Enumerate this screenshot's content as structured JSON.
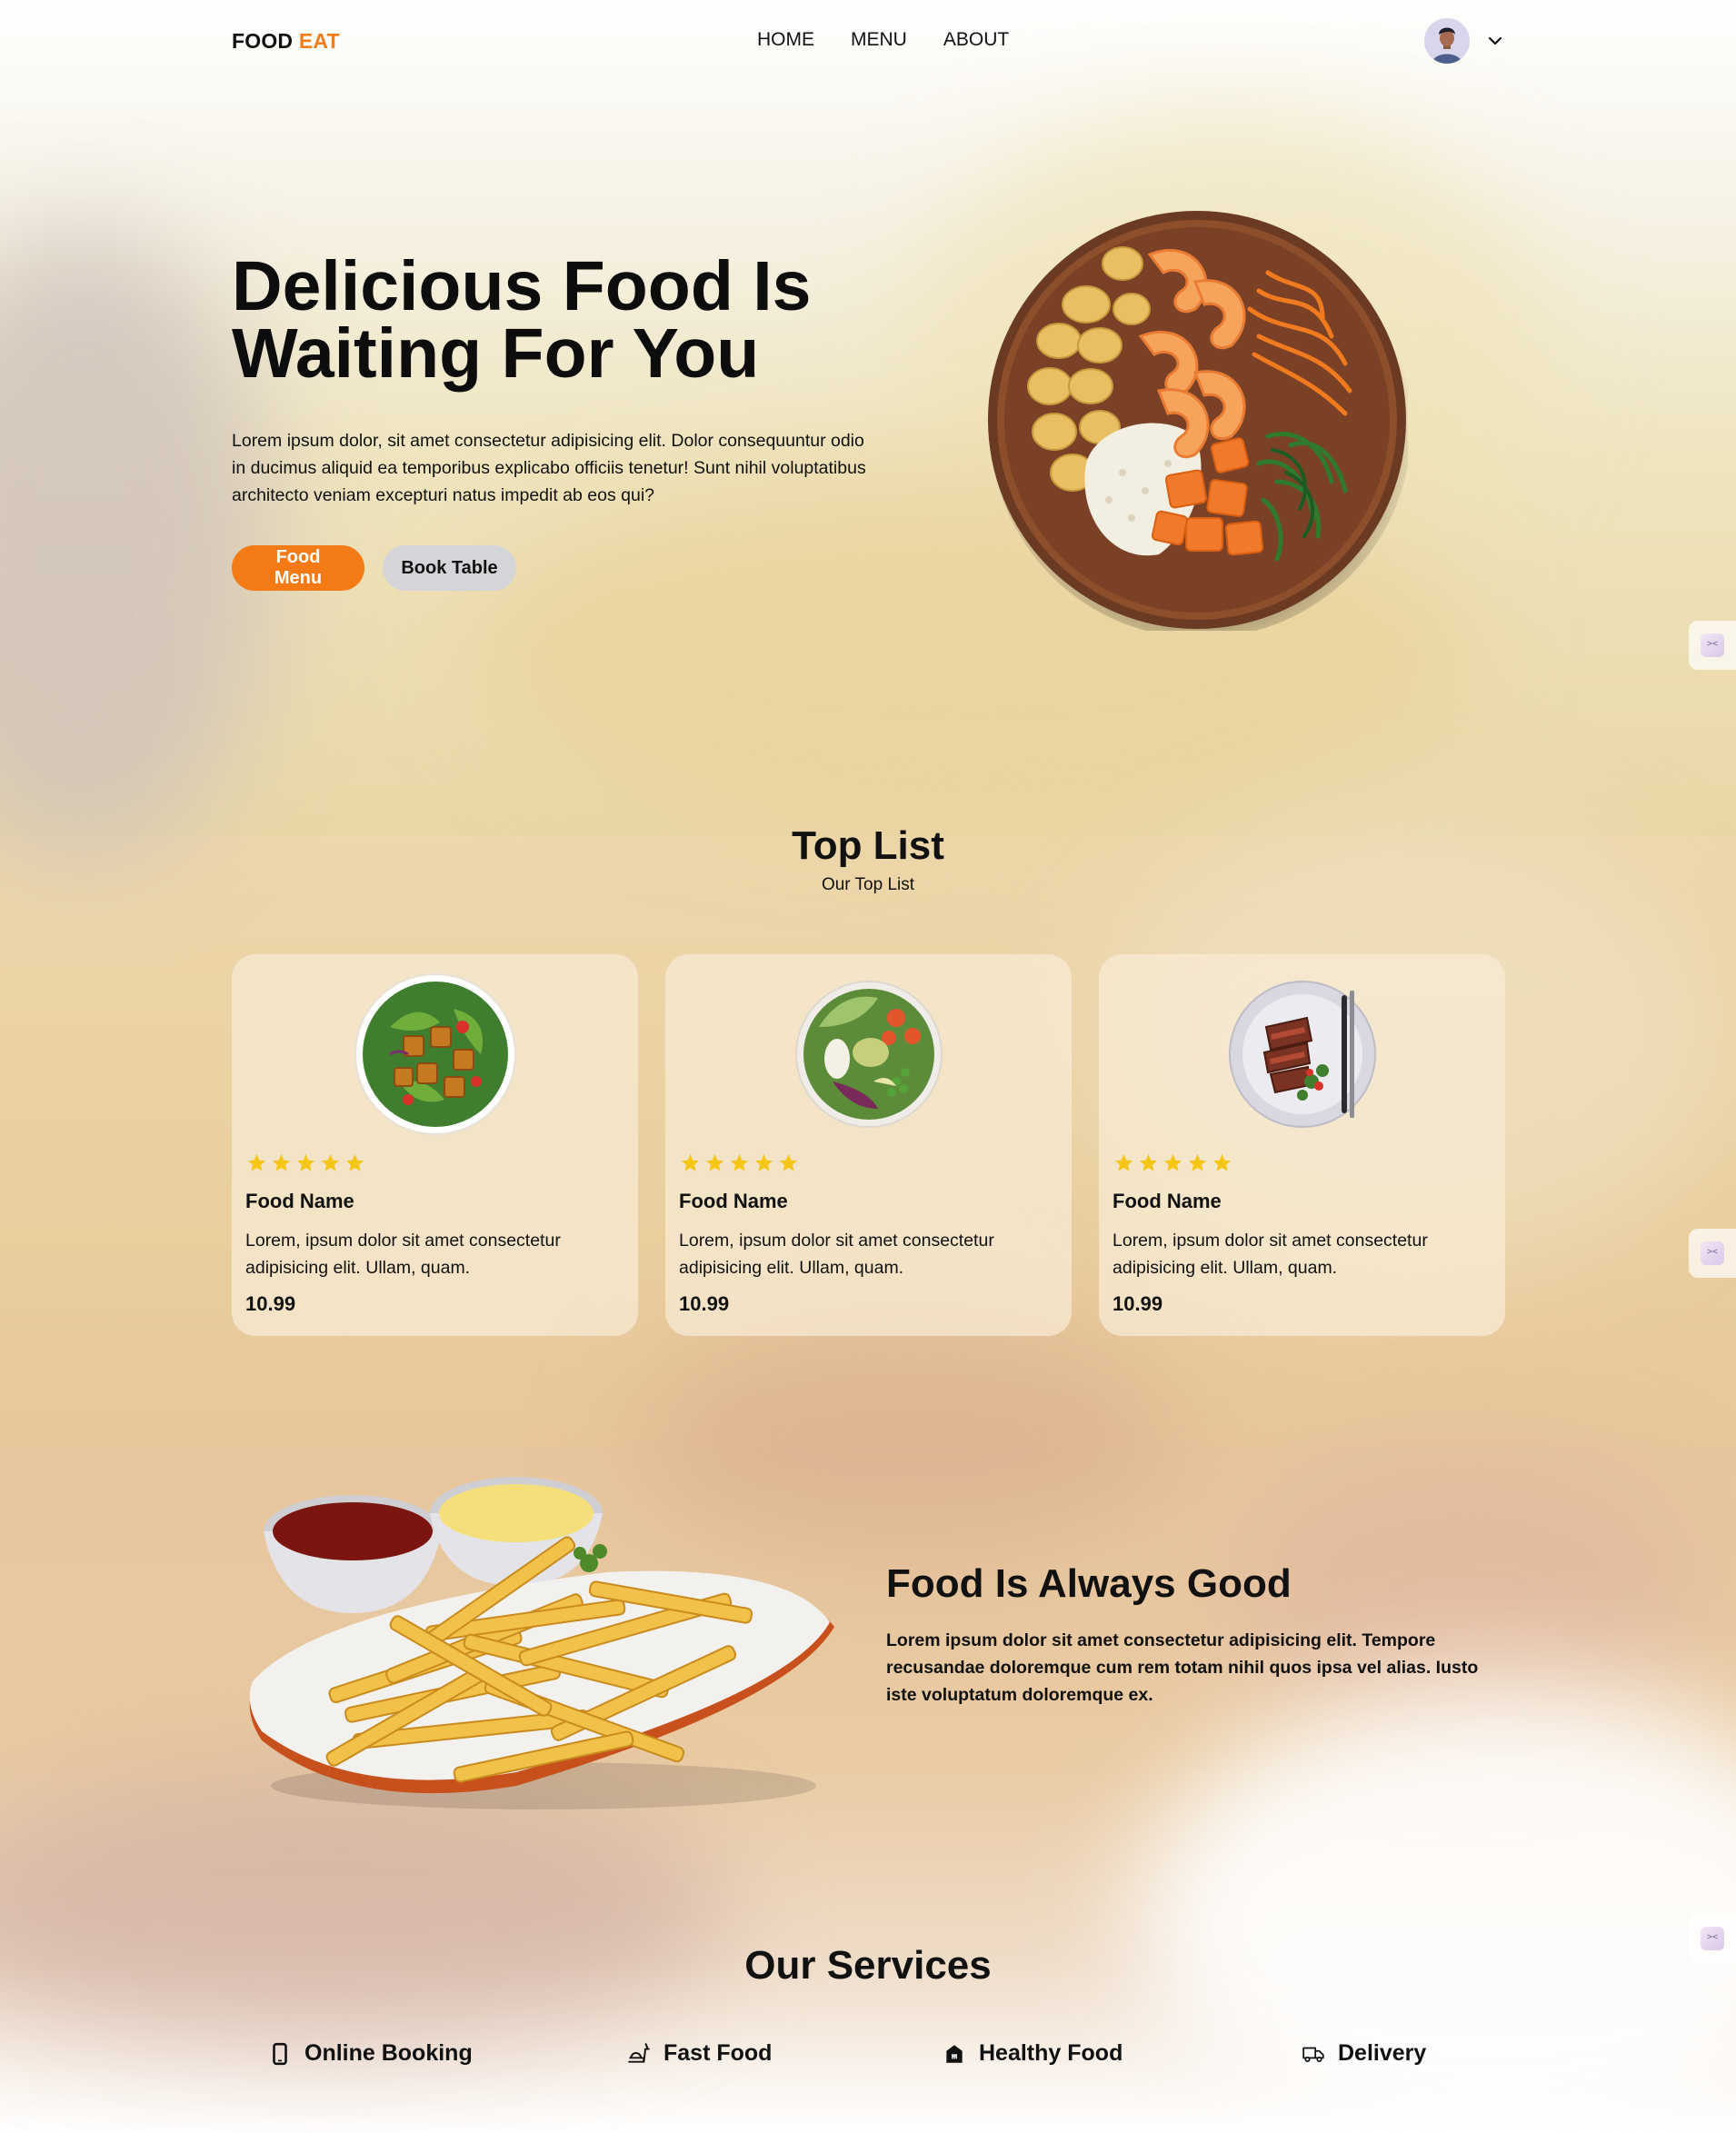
{
  "brand": {
    "part1": "FOOD",
    "part2": "EAT",
    "accent_color": "#f07c1a"
  },
  "nav": {
    "items": [
      "HOME",
      "MENU",
      "ABOUT"
    ]
  },
  "user": {
    "avatar_icon": "user-avatar-icon",
    "menu_icon": "chevron-down-icon"
  },
  "hero": {
    "title_line1": "Delicious Food Is",
    "title_line2": "Waiting For You",
    "text": "Lorem ipsum dolor, sit amet consectetur adipisicing elit. Dolor consequuntur odio in ducimus aliquid ea temporibus explicabo officiis tenetur! Sunt nihil voluptatibus architecto veniam excepturi natus impedit ab eos qui?",
    "primary_button": "Food Menu",
    "secondary_button": "Book Table",
    "primary_color": "#f47a15"
  },
  "top_list": {
    "title": "Top List",
    "subtitle": "Our Top List",
    "cards": [
      {
        "image": "salad-bowl",
        "rating": 5,
        "name": "Food Name",
        "description": "Lorem, ipsum dolor sit amet consectetur adipisicing elit. Ullam, quam.",
        "price": "10.99"
      },
      {
        "image": "veggie-bowl",
        "rating": 5,
        "name": "Food Name",
        "description": "Lorem, ipsum dolor sit amet consectetur adipisicing elit. Ullam, quam.",
        "price": "10.99"
      },
      {
        "image": "steak-plate",
        "rating": 5,
        "name": "Food Name",
        "description": "Lorem, ipsum dolor sit amet consectetur adipisicing elit. Ullam, quam.",
        "price": "10.99"
      }
    ],
    "star_color": "#f5c518"
  },
  "feature": {
    "image": "french-fries-plate",
    "title": "Food Is Always Good",
    "text": "Lorem ipsum dolor sit amet consectetur adipisicing elit. Tempore recusandae doloremque cum rem totam nihil quos ipsa vel alias. Iusto iste voluptatum doloremque ex."
  },
  "services": {
    "title": "Our Services",
    "items": [
      {
        "icon": "smartphone-icon",
        "label": "Online Booking"
      },
      {
        "icon": "fast-food-icon",
        "label": "Fast Food"
      },
      {
        "icon": "healthy-food-icon",
        "label": "Healthy Food"
      },
      {
        "icon": "delivery-truck-icon",
        "label": "Delivery"
      }
    ]
  }
}
